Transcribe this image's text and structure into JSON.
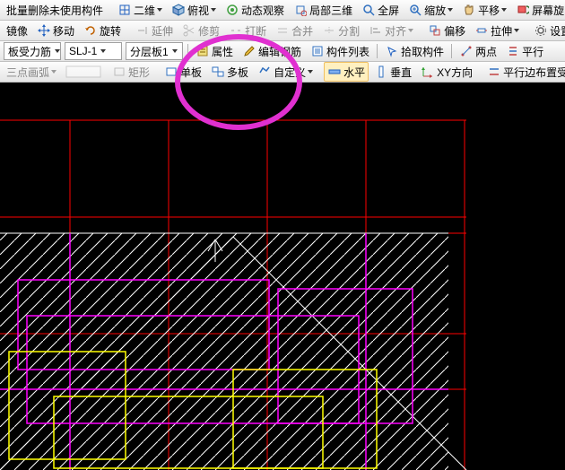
{
  "row1": {
    "del_unused": "批量删除未使用构件",
    "view2d": "二维",
    "overlook": "俯视",
    "dynobs": "动态观察",
    "local3d": "局部三维",
    "fullscreen": "全屏",
    "zoom": "缩放",
    "pan": "平移",
    "screen_rot": "屏幕旋"
  },
  "row2": {
    "mirror": "镜像",
    "move": "移动",
    "rotate": "旋转",
    "extend": "延伸",
    "trim": "修剪",
    "break": "打断",
    "merge": "合并",
    "split": "分割",
    "align": "对齐",
    "offset": "偏移",
    "stretch": "拉伸",
    "settings": "设置"
  },
  "row3": {
    "dd1": "板受力筋",
    "dd2": "SLJ-1",
    "dd3": "分层板1",
    "props": "属性",
    "edit_rebar": "编辑钢筋",
    "member_list": "构件列表",
    "pick_member": "拾取构件",
    "two_point": "两点",
    "parallel": "平行"
  },
  "row4": {
    "arc3p": "三点画弧",
    "rect": "矩形",
    "single_slab": "单板",
    "multi_slab": "多板",
    "custom": "自定义",
    "horizontal": "水平",
    "vertical": "垂直",
    "xy_dir": "XY方向",
    "parallel_edge": "平行边布置受"
  }
}
